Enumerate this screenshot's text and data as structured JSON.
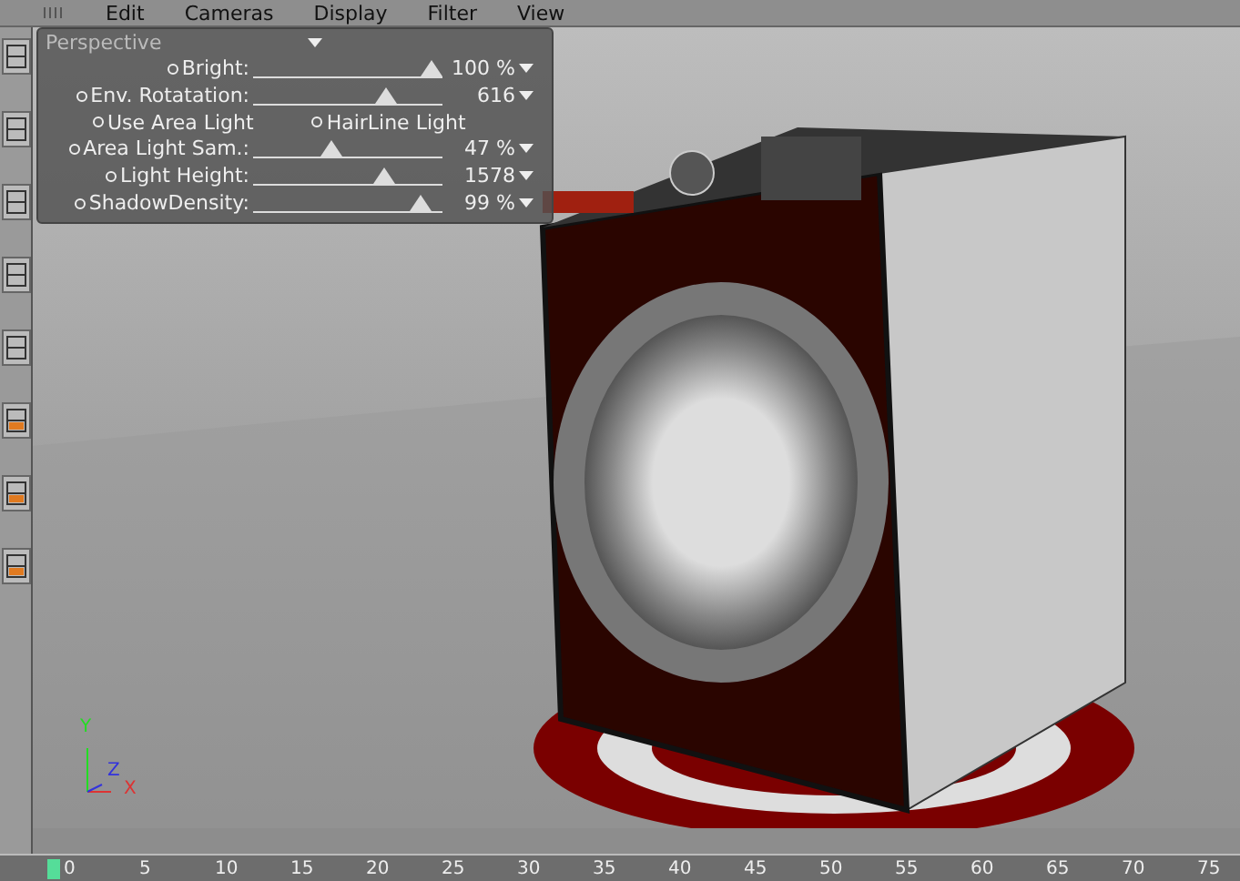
{
  "menu": [
    "Edit",
    "Cameras",
    "Display",
    "Filter",
    "View"
  ],
  "panel": {
    "title": "Perspective",
    "rows": [
      {
        "kind": "slider",
        "label": "Bright:",
        "level": 0.94,
        "reading": "100 %"
      },
      {
        "kind": "slider",
        "label": "Env. Rotatation:",
        "level": 0.7,
        "reading": "616"
      },
      {
        "kind": "toggles",
        "items": [
          "Use Area Light",
          "HairLine Light"
        ]
      },
      {
        "kind": "slider",
        "label": "Area Light Sam.:",
        "level": 0.41,
        "reading": "47 %"
      },
      {
        "kind": "slider",
        "label": "Light Height:",
        "level": 0.69,
        "reading": "1578"
      },
      {
        "kind": "slider",
        "label": "ShadowDensity:",
        "level": 0.88,
        "reading": "99 %"
      }
    ]
  },
  "axes": [
    "Y",
    "Z",
    "X"
  ],
  "timeline": {
    "ticks": [
      "0",
      "5",
      "10",
      "15",
      "20",
      "25",
      "30",
      "35",
      "40",
      "45",
      "50",
      "55",
      "60",
      "65",
      "70",
      "75"
    ]
  }
}
